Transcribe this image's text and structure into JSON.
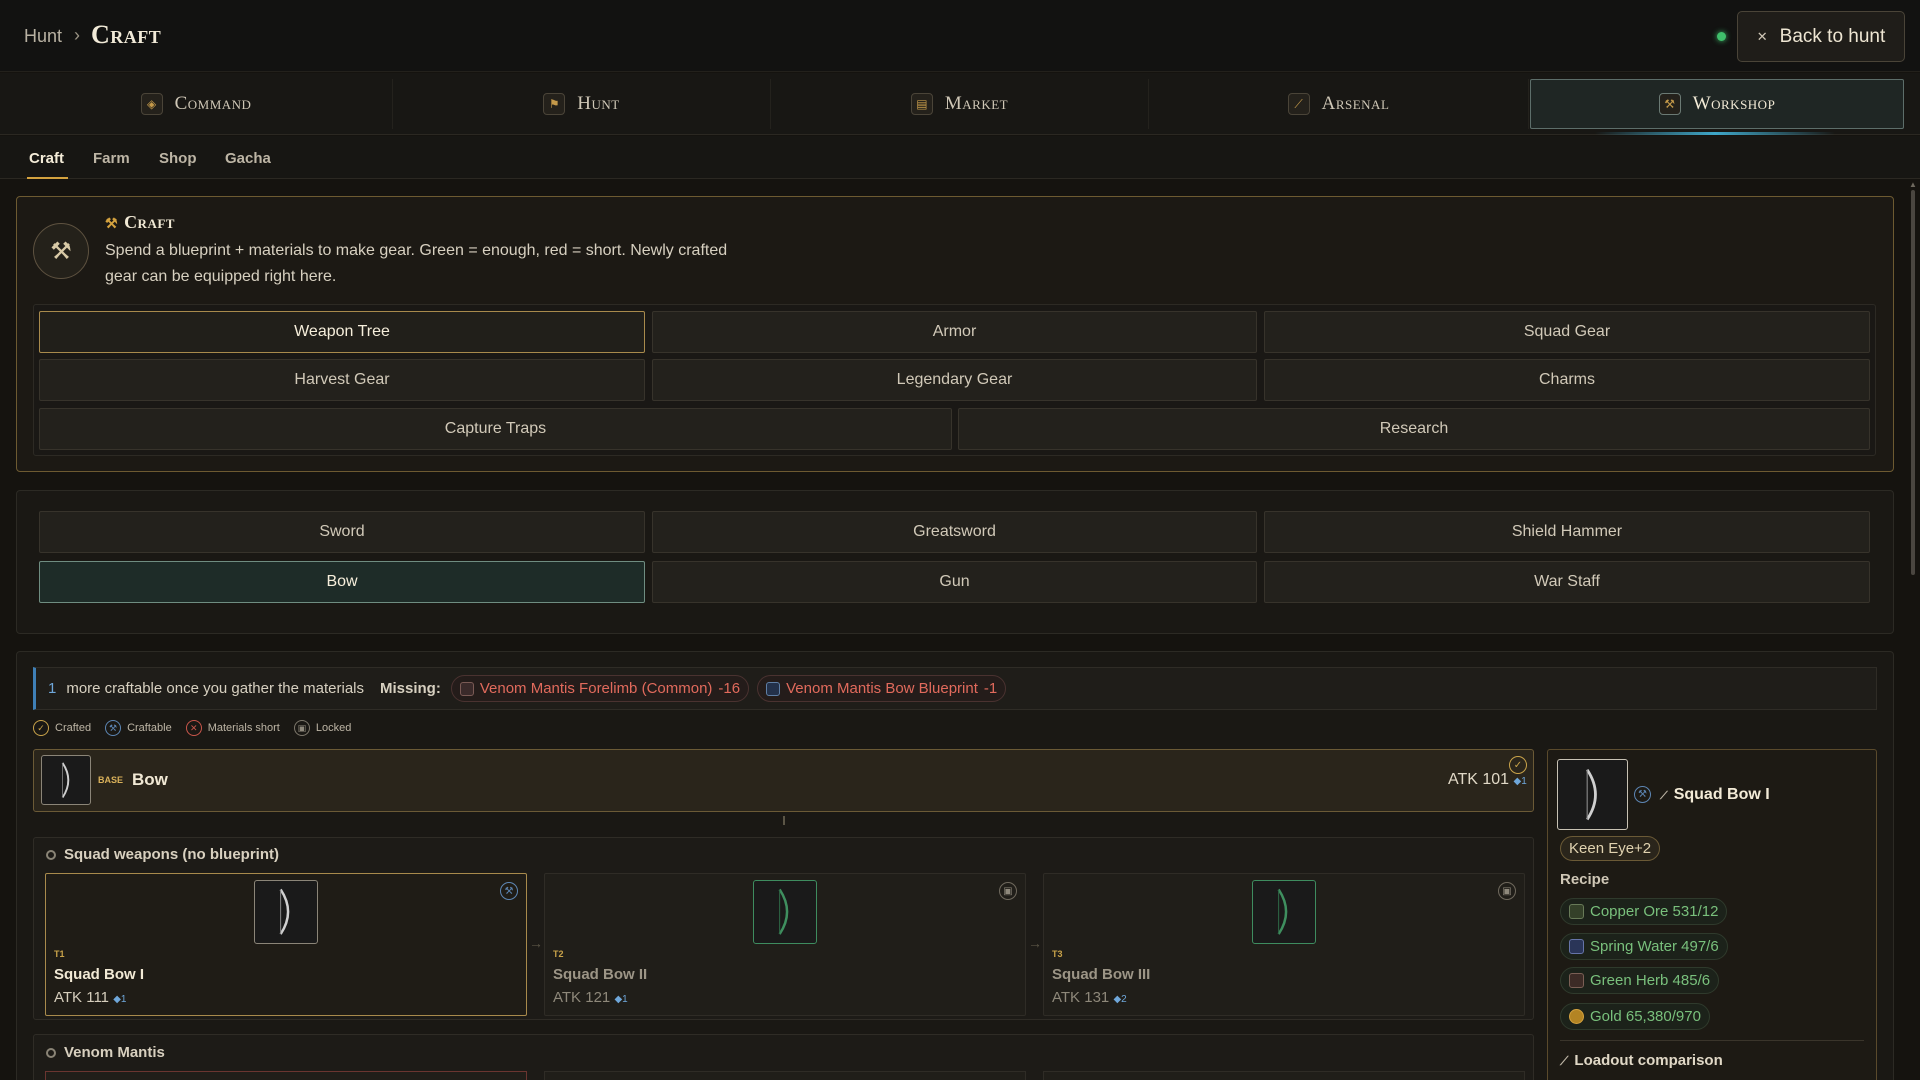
{
  "breadcrumb": {
    "parent": "Hunt",
    "separator": "›",
    "current": "Craft"
  },
  "top_actions": {
    "back_label": "Back to hunt",
    "back_icon": "close-icon",
    "status_color": "#3fbf6b"
  },
  "main_nav": [
    {
      "label": "Command",
      "icon": "crest-icon"
    },
    {
      "label": "Hunt",
      "icon": "flag-icon"
    },
    {
      "label": "Market",
      "icon": "stall-icon"
    },
    {
      "label": "Arsenal",
      "icon": "sword-icon"
    },
    {
      "label": "Workshop",
      "icon": "hammer-icon",
      "active": true
    }
  ],
  "sub_tabs": [
    {
      "label": "Craft",
      "active": true
    },
    {
      "label": "Farm"
    },
    {
      "label": "Shop"
    },
    {
      "label": "Gacha"
    }
  ],
  "craft": {
    "title": "Craft",
    "description": "Spend a blueprint + materials to make gear. Green = enough, red = short. Newly crafted gear can be equipped right here.",
    "categories": [
      "Weapon Tree",
      "Armor",
      "Squad Gear",
      "Harvest Gear",
      "Legendary Gear",
      "Charms",
      "Capture Traps",
      "Research"
    ],
    "selected_category": "Weapon Tree"
  },
  "weapon_types": {
    "items": [
      "Sword",
      "Greatsword",
      "Shield Hammer",
      "Bow",
      "Gun",
      "War Staff"
    ],
    "selected": "Bow"
  },
  "missing": {
    "count": "1",
    "text": "more craftable once you gather the materials",
    "label": "Missing:",
    "items": [
      {
        "label": "Venom Mantis Forelimb (Common)",
        "amount": "-16"
      },
      {
        "label": "Venom Mantis Bow Blueprint",
        "amount": "-1"
      }
    ]
  },
  "legend": [
    "Crafted",
    "Craftable",
    "Materials short",
    "Locked"
  ],
  "base": {
    "tag": "BASE",
    "name": "Bow",
    "atk": "ATK 101",
    "atk_plus": "◆1",
    "status": "crafted"
  },
  "groups": [
    {
      "title": "Squad weapons (no blueprint)",
      "cards": [
        {
          "tier": "T1",
          "name": "Squad Bow I",
          "atk": "ATK 111",
          "atk_plus": "◆1",
          "status": "craftable",
          "selected": true
        },
        {
          "tier": "T2",
          "name": "Squad Bow II",
          "atk": "ATK 121",
          "atk_plus": "◆1",
          "status": "locked"
        },
        {
          "tier": "T3",
          "name": "Squad Bow III",
          "atk": "ATK 131",
          "atk_plus": "◆2",
          "status": "locked"
        }
      ]
    },
    {
      "title": "Venom Mantis"
    }
  ],
  "detail": {
    "name": "Squad Bow I",
    "trait": "Keen Eye+2",
    "recipe_label": "Recipe",
    "materials": [
      {
        "label": "Copper Ore 531/12",
        "icon": "ore-icon"
      },
      {
        "label": "Spring Water 497/6",
        "icon": "water-icon"
      },
      {
        "label": "Green Herb 485/6",
        "icon": "herb-icon"
      },
      {
        "label": "Gold 65,380/970",
        "icon": "gold-coin-icon"
      }
    ],
    "loadout_label": "Loadout comparison"
  },
  "colors": {
    "accent_gold": "#d4a23f",
    "enough_green": "#79c07c",
    "short_red": "#e16a5c",
    "craftable_blue": "#5d86b4"
  }
}
